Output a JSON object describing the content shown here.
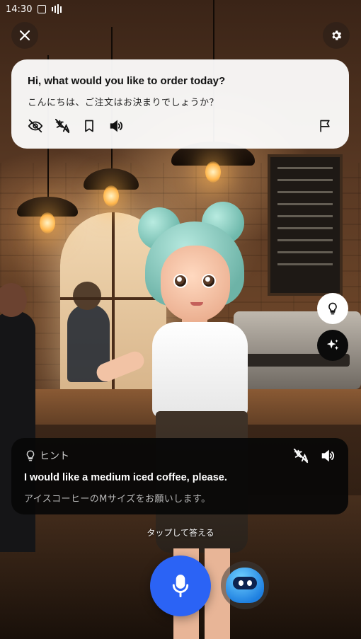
{
  "status_bar": {
    "time": "14:30"
  },
  "question": {
    "english": "Hi, what would you like to order today?",
    "japanese": "こんにちは、ご注文はお決まりでしょうか？"
  },
  "hint": {
    "label": "ヒント",
    "english": "I would like a medium iced coffee, please.",
    "japanese": "アイスコーヒーのMサイズをお願いします。"
  },
  "tap_prompt": "タップして答える",
  "colors": {
    "mic_button": "#2b63f5",
    "question_card": "#ffffff",
    "hint_card": "#080808"
  },
  "icons": {
    "close": "close-icon",
    "settings": "gear-icon",
    "hide": "eye-off-icon",
    "translate_off": "translate-off-icon",
    "bookmark": "bookmark-icon",
    "speaker": "speaker-icon",
    "report": "flag-icon",
    "hint": "lightbulb-icon",
    "sparkle": "sparkle-icon",
    "mic": "mic-icon"
  }
}
